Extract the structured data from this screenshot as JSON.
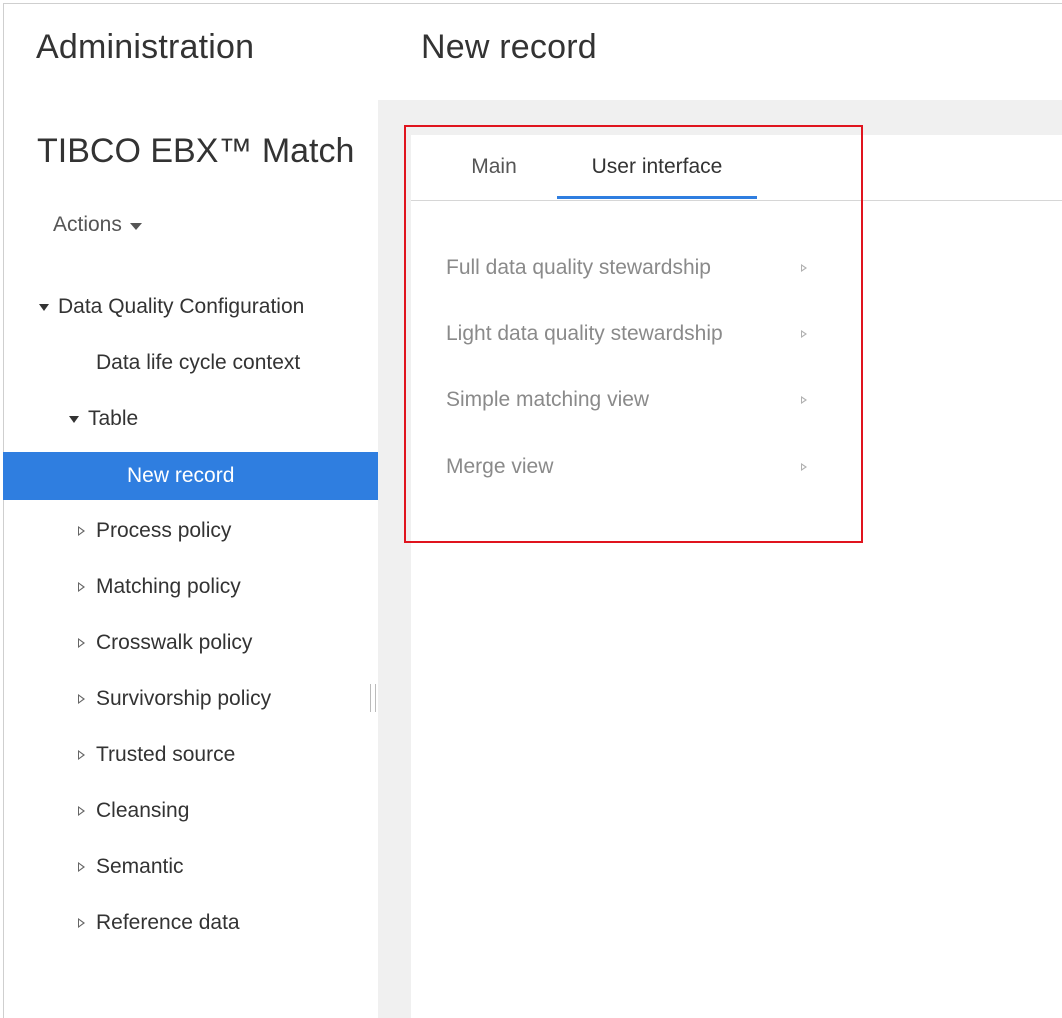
{
  "header": {
    "section_title": "Administration",
    "page_title": "New record"
  },
  "sidebar": {
    "app_name": "TIBCO EBX™ Match",
    "actions_label": "Actions",
    "tree": [
      {
        "label": "Data Quality Configuration",
        "expanded": true
      },
      {
        "label": "Data life cycle context"
      },
      {
        "label": "Table",
        "expanded": true
      },
      {
        "label": "New record",
        "selected": true
      },
      {
        "label": "Process policy",
        "expanded": false
      },
      {
        "label": "Matching policy",
        "expanded": false
      },
      {
        "label": "Crosswalk policy",
        "expanded": false
      },
      {
        "label": "Survivorship policy",
        "expanded": false
      },
      {
        "label": "Trusted source",
        "expanded": false
      },
      {
        "label": "Cleansing",
        "expanded": false
      },
      {
        "label": "Semantic",
        "expanded": false
      },
      {
        "label": "Reference data",
        "expanded": false
      }
    ]
  },
  "tabs": [
    {
      "label": "Main",
      "active": false
    },
    {
      "label": "User interface",
      "active": true
    }
  ],
  "user_interface_items": [
    {
      "label": "Full data quality stewardship"
    },
    {
      "label": "Light data quality stewardship"
    },
    {
      "label": "Simple matching view"
    },
    {
      "label": "Merge view"
    }
  ],
  "colors": {
    "accent": "#2f7ee0",
    "highlight": "#e0141e",
    "content_bg": "#f0f0f0"
  }
}
